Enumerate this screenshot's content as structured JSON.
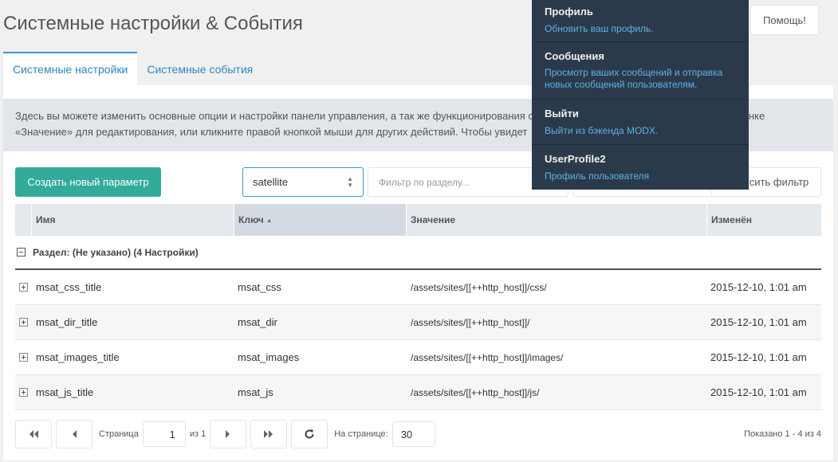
{
  "page": {
    "title": "Системные настройки & События",
    "help_label": "Помощь!"
  },
  "tabs": [
    {
      "label": "Системные настройки",
      "active": true
    },
    {
      "label": "Системные события",
      "active": false
    }
  ],
  "info_text": {
    "line1": "Здесь вы можете изменить основные опции и настройки панели управления, а так же функционирования с",
    "line1_tail": "нке",
    "line2": "«Значение» для редактирования, или кликните правой кнопкой мыши для других действий. Чтобы увидет"
  },
  "toolbar": {
    "create_label": "Создать новый параметр",
    "namespace_value": "satellite",
    "area_placeholder": "Фильтр по разделу...",
    "reset_label": "Сбросить фильтр",
    "reset_visible": "сить фильтр"
  },
  "grid": {
    "columns": [
      "Имя",
      "Ключ",
      "Значение",
      "Изменён"
    ],
    "sorted_column": "Ключ",
    "group_label": "Раздел: (Не указано) (4 Настройки)",
    "rows": [
      {
        "name": "msat_css_title",
        "key": "msat_css",
        "value": "/assets/sites/[[++http_host]]/css/",
        "edited": "2015-12-10, 1:01 am"
      },
      {
        "name": "msat_dir_title",
        "key": "msat_dir",
        "value": "/assets/sites/[[++http_host]]/",
        "edited": "2015-12-10, 1:01 am"
      },
      {
        "name": "msat_images_title",
        "key": "msat_images",
        "value": "/assets/sites/[[++http_host]]/images/",
        "edited": "2015-12-10, 1:01 am"
      },
      {
        "name": "msat_js_title",
        "key": "msat_js",
        "value": "/assets/sites/[[++http_host]]/js/",
        "edited": "2015-12-10, 1:01 am"
      }
    ]
  },
  "pager": {
    "page_label": "Страница",
    "page_value": "1",
    "of_label": "из 1",
    "per_page_label": "На странице:",
    "per_page_value": "30",
    "summary": "Показано 1 - 4 из 4"
  },
  "user_menu": [
    {
      "title": "Профиль",
      "desc": "Обновить ваш профиль."
    },
    {
      "title": "Сообщения",
      "desc": "Просмотр ваших сообщений и отправка новых сообщений пользователям."
    },
    {
      "title": "Выйти",
      "desc": "Выйти из бэкенда MODX."
    },
    {
      "title": "UserProfile2",
      "desc": "Профиль пользователя"
    }
  ],
  "colors": {
    "accent": "#3697cd",
    "create_button": "#32ab9a",
    "menu_bg": "#2b3a4a",
    "menu_link": "#5db1e8"
  },
  "icons": {
    "pager_first": "double-chevron-left-icon",
    "pager_prev": "chevron-left-icon",
    "pager_next": "chevron-right-icon",
    "pager_last": "double-chevron-right-icon",
    "refresh": "refresh-icon",
    "collapse": "minus-box-icon",
    "expand": "plus-box-icon",
    "select_arrows": "up-down-arrows-icon",
    "sort": "sort-ascending-icon"
  }
}
